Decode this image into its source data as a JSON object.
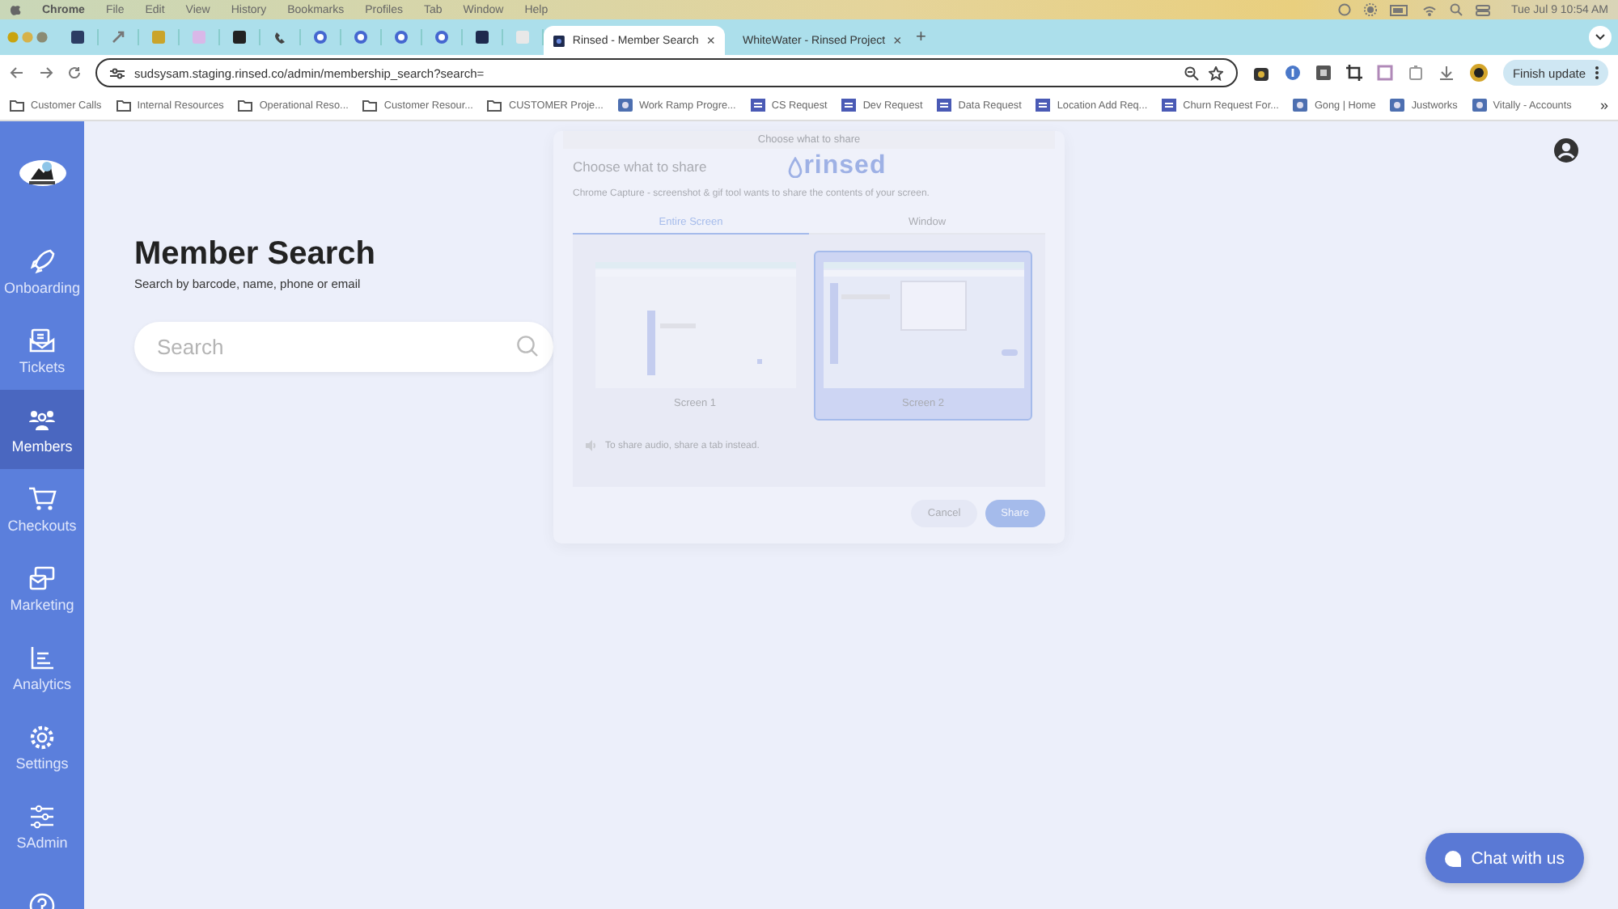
{
  "menu_bar": {
    "app": "Chrome",
    "items": [
      "File",
      "Edit",
      "View",
      "History",
      "Bookmarks",
      "Profiles",
      "Tab",
      "Window",
      "Help"
    ],
    "clock": "Tue Jul 9  10:54 AM"
  },
  "tabs": [
    {
      "label": "Rinsed - Member Search",
      "selected": true,
      "close": "×"
    },
    {
      "label": "WhiteWater - Rinsed Project",
      "selected": false,
      "close": "×"
    }
  ],
  "new_tab": "+",
  "address": {
    "url": "sudsysam.staging.rinsed.co/admin/membership_search?search=",
    "update": "Finish update"
  },
  "bookmarks": [
    {
      "label": "Customer Calls",
      "kind": "folder"
    },
    {
      "label": "Internal Resources",
      "kind": "folder"
    },
    {
      "label": "Operational Reso...",
      "kind": "folder"
    },
    {
      "label": "Customer Resour...",
      "kind": "folder"
    },
    {
      "label": "CUSTOMER Proje...",
      "kind": "folder"
    },
    {
      "label": "Work Ramp Progre...",
      "kind": "site"
    },
    {
      "label": "CS Request",
      "kind": "form"
    },
    {
      "label": "Dev Request",
      "kind": "form"
    },
    {
      "label": "Data Request",
      "kind": "form"
    },
    {
      "label": "Location Add Req...",
      "kind": "form"
    },
    {
      "label": "Churn Request For...",
      "kind": "form"
    },
    {
      "label": "Gong | Home",
      "kind": "site"
    },
    {
      "label": "Justworks",
      "kind": "site"
    },
    {
      "label": "Vitally - Accounts",
      "kind": "site"
    }
  ],
  "bookmarks_more": "»",
  "sidebar": {
    "items": [
      {
        "label": "Onboarding",
        "selected": false
      },
      {
        "label": "Tickets",
        "selected": false
      },
      {
        "label": "Members",
        "selected": true
      },
      {
        "label": "Checkouts",
        "selected": false
      },
      {
        "label": "Marketing",
        "selected": false
      },
      {
        "label": "Analytics",
        "selected": false
      },
      {
        "label": "Settings",
        "selected": false
      },
      {
        "label": "SAdmin",
        "selected": false
      },
      {
        "selected": false
      }
    ]
  },
  "main": {
    "title": "Member Search",
    "subtitle": "Search by barcode, name, phone or email",
    "search": {
      "placeholder": "Search"
    }
  },
  "share_dialog": {
    "window_title": "Choose what to share",
    "heading": "Choose what to share",
    "logo": "rinsed",
    "message": "Chrome Capture - screenshot & gif tool wants to share the contents of your screen.",
    "tabs": [
      {
        "label": "Entire Screen",
        "selected": true
      },
      {
        "label": "Window",
        "selected": false
      }
    ],
    "screens": [
      {
        "label": "Screen 1",
        "selected": false
      },
      {
        "label": "Screen 2",
        "selected": true
      }
    ],
    "audio_note": "To share audio, share a tab instead.",
    "buttons": [
      {
        "label": "Cancel",
        "kind": "secondary"
      },
      {
        "label": "Share",
        "kind": "primary"
      }
    ]
  },
  "chat": {
    "label": "Chat with us"
  }
}
